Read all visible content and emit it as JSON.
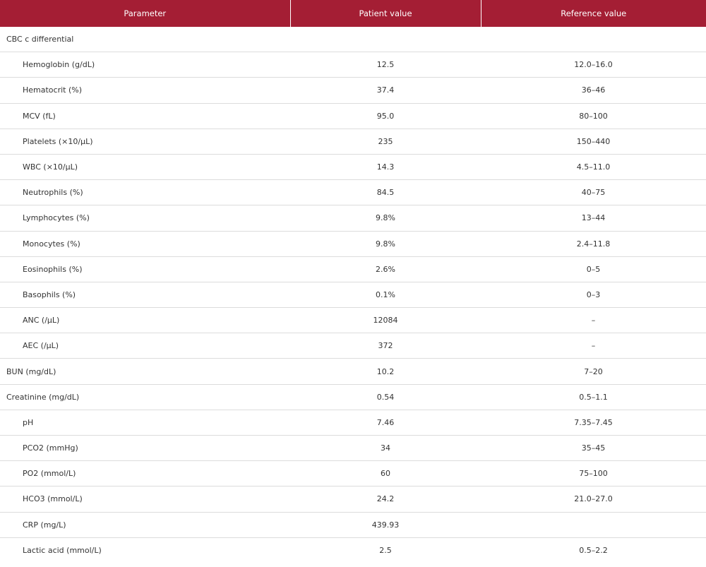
{
  "table": {
    "header_color": "#a41e34",
    "columns": [
      "Parameter",
      "Patient value",
      "Reference value"
    ],
    "rows": [
      {
        "parameter": "CBC c differential",
        "patient": "",
        "reference": "",
        "indent": false
      },
      {
        "parameter": "Hemoglobin (g/dL)",
        "patient": "12.5",
        "reference": "12.0–16.0",
        "indent": true
      },
      {
        "parameter": "Hematocrit (%)",
        "patient": "37.4",
        "reference": "36–46",
        "indent": true
      },
      {
        "parameter": "MCV (fL)",
        "patient": "95.0",
        "reference": "80–100",
        "indent": true
      },
      {
        "parameter": "Platelets (×10/μL)",
        "patient": "235",
        "reference": "150–440",
        "indent": true
      },
      {
        "parameter": "WBC (×10/μL)",
        "patient": "14.3",
        "reference": "4.5–11.0",
        "indent": true
      },
      {
        "parameter": "Neutrophils (%)",
        "patient": "84.5",
        "reference": "40–75",
        "indent": true
      },
      {
        "parameter": "Lymphocytes (%)",
        "patient": "9.8%",
        "reference": "13–44",
        "indent": true
      },
      {
        "parameter": "Monocytes (%)",
        "patient": "9.8%",
        "reference": "2.4–11.8",
        "indent": true
      },
      {
        "parameter": "Eosinophils (%)",
        "patient": "2.6%",
        "reference": "0–5",
        "indent": true
      },
      {
        "parameter": "Basophils (%)",
        "patient": "0.1%",
        "reference": "0–3",
        "indent": true
      },
      {
        "parameter": "ANC (/μL)",
        "patient": "12084",
        "reference": "–",
        "indent": true
      },
      {
        "parameter": "AEC (/μL)",
        "patient": "372",
        "reference": "–",
        "indent": true
      },
      {
        "parameter": "BUN (mg/dL)",
        "patient": "10.2",
        "reference": "7–20",
        "indent": false
      },
      {
        "parameter": "Creatinine (mg/dL)",
        "patient": "0.54",
        "reference": "0.5–1.1",
        "indent": false
      },
      {
        "parameter": "pH",
        "patient": "7.46",
        "reference": "7.35–7.45",
        "indent": true
      },
      {
        "parameter": "PCO2 (mmHg)",
        "patient": "34",
        "reference": "35–45",
        "indent": true
      },
      {
        "parameter": "PO2 (mmol/L)",
        "patient": "60",
        "reference": "75–100",
        "indent": true
      },
      {
        "parameter": "HCO3 (mmol/L)",
        "patient": "24.2",
        "reference": "21.0–27.0",
        "indent": true
      },
      {
        "parameter": "CRP (mg/L)",
        "patient": "439.93",
        "reference": "",
        "indent": true
      },
      {
        "parameter": "Lactic acid (mmol/L)",
        "patient": "2.5",
        "reference": "0.5–2.2",
        "indent": true
      }
    ]
  }
}
